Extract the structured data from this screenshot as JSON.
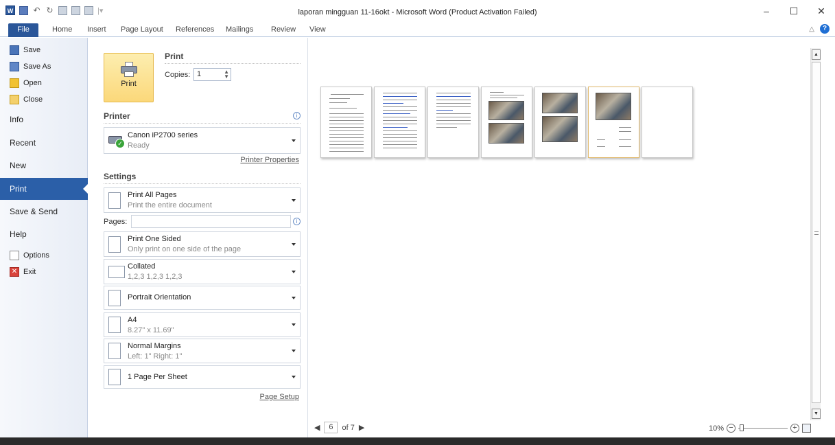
{
  "titlebar": {
    "title": "laporan mingguan 11-16okt  -  Microsoft Word (Product Activation Failed)",
    "app_icon": "W",
    "controls": [
      "–",
      "☐",
      "✕"
    ]
  },
  "ribbon": {
    "tabs": [
      "File",
      "Home",
      "Insert",
      "Page Layout",
      "References",
      "Mailings",
      "Review",
      "View"
    ],
    "help": "?"
  },
  "backstage": {
    "commands": [
      {
        "label": "Save",
        "icon": "save-icon"
      },
      {
        "label": "Save As",
        "icon": "save-as-icon"
      },
      {
        "label": "Open",
        "icon": "open-folder-icon"
      },
      {
        "label": "Close",
        "icon": "close-folder-icon"
      }
    ],
    "tabs": [
      "Info",
      "Recent",
      "New",
      "Print",
      "Save & Send",
      "Help"
    ],
    "active_tab": "Print",
    "footer_commands": [
      {
        "label": "Options",
        "icon": "options-icon"
      },
      {
        "label": "Exit",
        "icon": "exit-icon"
      }
    ]
  },
  "print": {
    "section_title": "Print",
    "button_label": "Print",
    "copies_label": "Copies:",
    "copies_value": "1",
    "printer_title": "Printer",
    "printer_name": "Canon iP2700 series",
    "printer_status": "Ready",
    "printer_properties": "Printer Properties",
    "settings_title": "Settings",
    "pages_label": "Pages:",
    "pages_value": "",
    "settings": [
      {
        "main": "Print All Pages",
        "sub": "Print the entire document"
      },
      {
        "main": "Print One Sided",
        "sub": "Only print on one side of the page"
      },
      {
        "main": "Collated",
        "sub": "1,2,3   1,2,3   1,2,3"
      },
      {
        "main": "Portrait Orientation",
        "sub": ""
      },
      {
        "main": "A4",
        "sub": "8.27\" x 11.69\""
      },
      {
        "main": "Normal Margins",
        "sub": "Left:  1\"   Right:  1\""
      },
      {
        "main": "1 Page Per Sheet",
        "sub": ""
      }
    ],
    "page_setup": "Page Setup"
  },
  "preview": {
    "current_page": "6",
    "of_pages": "of 7",
    "zoom": "10%",
    "thumbnail_count": 7,
    "selected_thumbnail": 6
  },
  "colors": {
    "file_tab": "#2a5699",
    "active_nav": "#2b5fa8",
    "print_button": "#fbd87a"
  }
}
